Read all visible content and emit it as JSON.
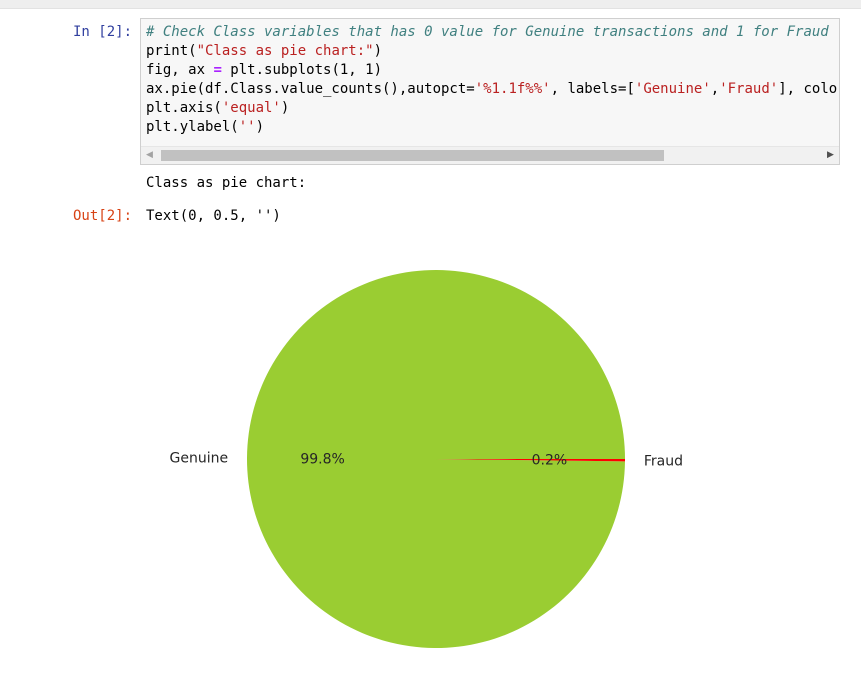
{
  "cell": {
    "in_prompt": "In [2]:",
    "out_prompt": "Out[2]:",
    "code_lines": [
      [
        {
          "t": "# Check Class variables that has 0 value for Genuine transactions and 1 for Fraud",
          "c": "cm"
        }
      ],
      [
        {
          "t": "print(",
          "c": ""
        },
        {
          "t": "\"Class as pie chart:\"",
          "c": "str"
        },
        {
          "t": ")",
          "c": ""
        }
      ],
      [
        {
          "t": "fig, ax ",
          "c": ""
        },
        {
          "t": "=",
          "c": "op"
        },
        {
          "t": " plt.subplots(1, 1)",
          "c": ""
        }
      ],
      [
        {
          "t": "ax.pie(df.Class.value_counts(),autopct=",
          "c": ""
        },
        {
          "t": "'%1.1f%%'",
          "c": "str"
        },
        {
          "t": ", labels=[",
          "c": ""
        },
        {
          "t": "'Genuine'",
          "c": "str"
        },
        {
          "t": ",",
          "c": ""
        },
        {
          "t": "'Fraud'",
          "c": "str"
        },
        {
          "t": "], colors=[",
          "c": ""
        }
      ],
      [
        {
          "t": "plt.axis(",
          "c": ""
        },
        {
          "t": "'equal'",
          "c": "str"
        },
        {
          "t": ")",
          "c": ""
        }
      ],
      [
        {
          "t": "plt.ylabel(",
          "c": ""
        },
        {
          "t": "''",
          "c": "str"
        },
        {
          "t": ")",
          "c": ""
        }
      ]
    ],
    "stream_output": "Class as pie chart:",
    "result_output": "Text(0, 0.5, '')"
  },
  "icons": {
    "scroll_left": "◀",
    "scroll_right": "▶"
  },
  "colors": {
    "genuine": "#9acd32",
    "fraud": "#ff0000"
  },
  "chart_data": {
    "type": "pie",
    "labels": [
      "Genuine",
      "Fraud"
    ],
    "values": [
      99.8,
      0.2
    ],
    "autopct": [
      "99.8%",
      "0.2%"
    ],
    "colors": [
      "#9acd32",
      "#ff0000"
    ]
  }
}
